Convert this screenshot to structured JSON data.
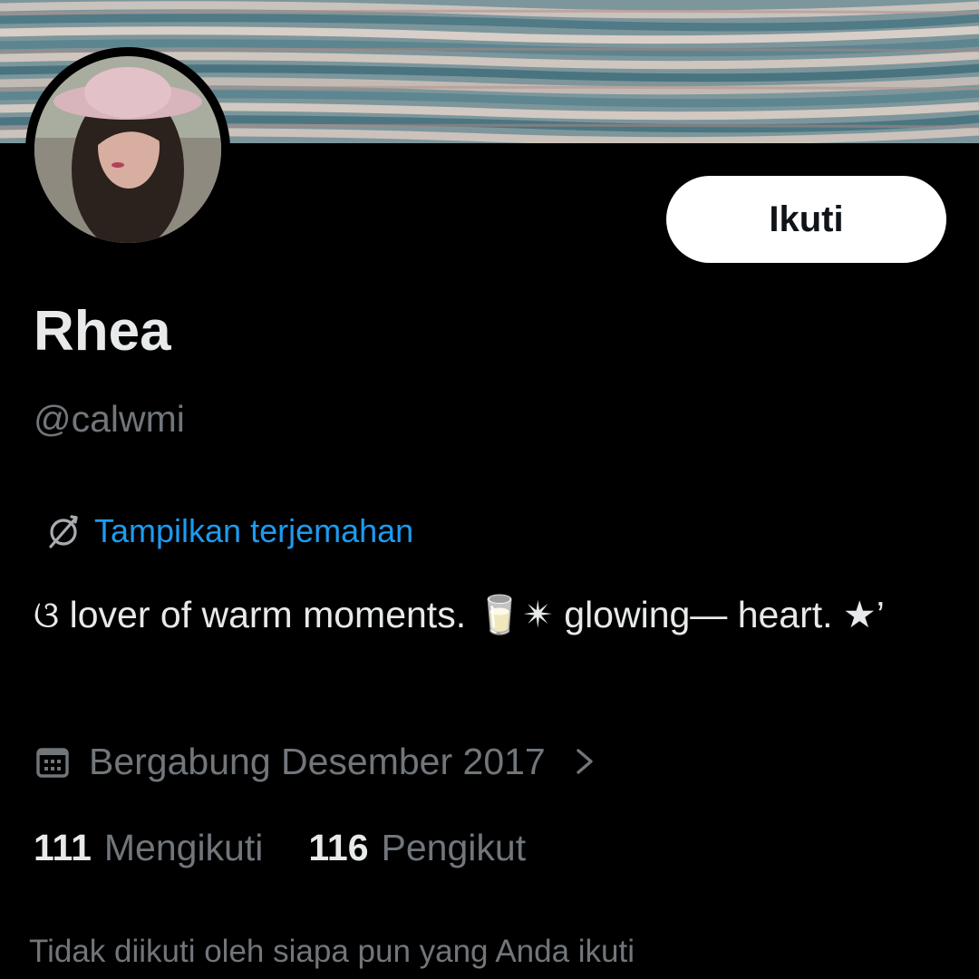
{
  "profile": {
    "display_name": "Rhea",
    "handle": "@calwmi",
    "follow_label": "Ikuti",
    "translate_label": "Tampilkan terjemahan",
    "bio": "ଓ lover of warm moments. 🥛✴ glowing— heart. ★’",
    "joined": "Bergabung Desember 2017",
    "following_count": "111",
    "following_label": "Mengikuti",
    "followers_count": "116",
    "followers_label": "Pengikut",
    "mutuals_text": "Tidak diikuti oleh siapa pun yang Anda ikuti"
  },
  "icons": {
    "translate": "globe-slash-icon",
    "joined": "calendar-icon",
    "chevron": "chevron-right-icon"
  },
  "colors": {
    "background": "#000000",
    "primary_text": "#e7e9ea",
    "secondary_text": "#71767b",
    "link": "#1d9bf0",
    "follow_button_bg": "#ffffff",
    "follow_button_text": "#0f1419"
  }
}
